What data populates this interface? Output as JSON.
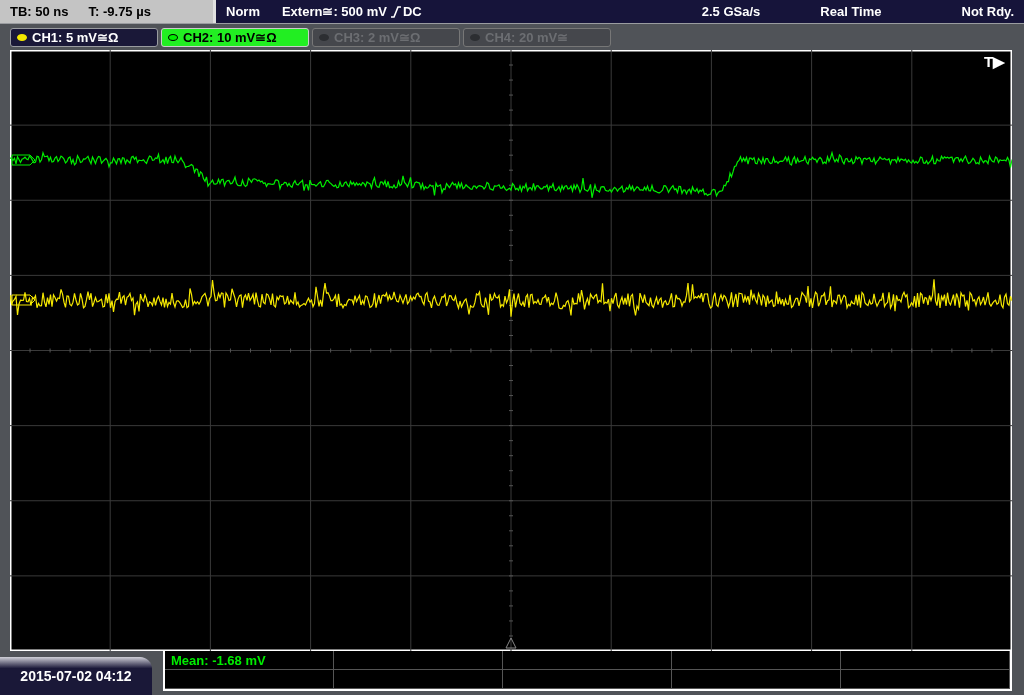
{
  "status_bar": {
    "timebase": "TB: 50 ns",
    "trigger_time": "T: -9.75 µs",
    "mode": "Norm",
    "trigger_source": "Extern≅: 500 mV",
    "coupling": "DC",
    "sample_rate": "2.5 GSa/s",
    "acquisition": "Real Time",
    "state": "Not Rdy."
  },
  "channels": [
    {
      "label": "CH1: 5 mV≅Ω",
      "color": "#f5e800",
      "selected": false,
      "enabled": true
    },
    {
      "label": "CH2: 10 mV≅Ω",
      "color": "#00ee00",
      "selected": true,
      "enabled": true
    },
    {
      "label": "CH3: 2 mV≅Ω",
      "selected": false,
      "enabled": false
    },
    {
      "label": "CH4: 20 mV≅",
      "selected": false,
      "enabled": false
    }
  ],
  "trigger_marker": "T▶",
  "datetime": "2015-07-02 04:12",
  "measurements": [
    {
      "text": "Mean: -1.68 mV"
    }
  ]
}
